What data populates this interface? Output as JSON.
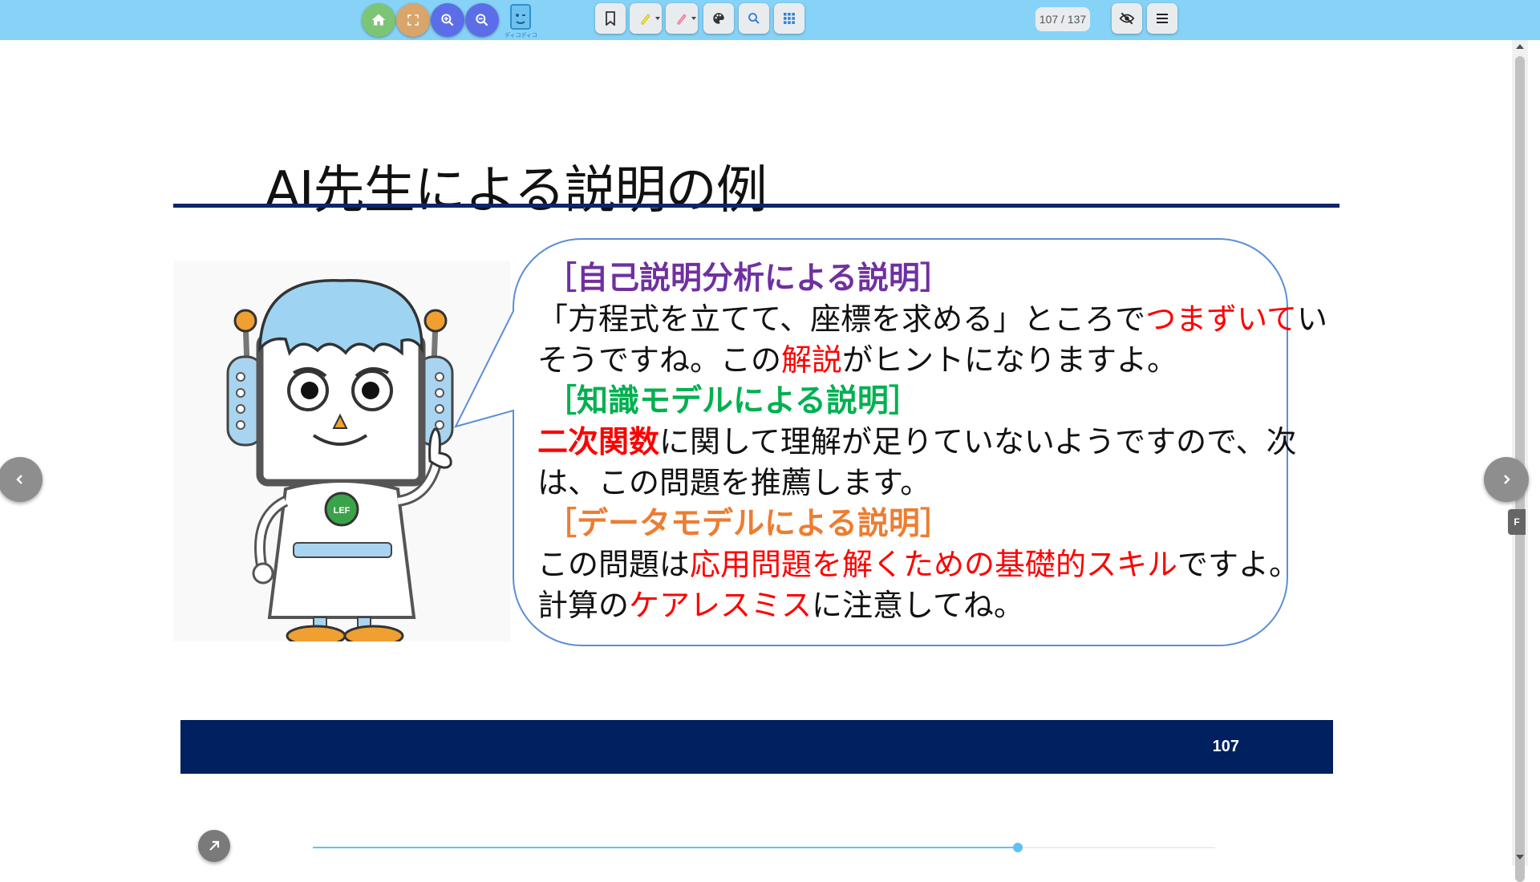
{
  "toolbar": {
    "buttons": [
      {
        "id": "home",
        "icon": "home-icon",
        "color": "#7cc576"
      },
      {
        "id": "fullscreen",
        "icon": "fullscreen-icon",
        "color": "#d9a56b"
      },
      {
        "id": "zoom-in",
        "icon": "zoom-in-icon",
        "color": "#5b6ee8"
      },
      {
        "id": "zoom-out",
        "icon": "zoom-out-icon",
        "color": "#5b6ee8"
      }
    ],
    "logo_text": "ディコディコ",
    "tools": [
      {
        "id": "bookmark",
        "icon": "bookmark-icon"
      },
      {
        "id": "highlighter",
        "icon": "highlighter-icon",
        "color": "#f2e84b"
      },
      {
        "id": "marker",
        "icon": "marker-icon",
        "color": "#f4a3b5"
      },
      {
        "id": "palette",
        "icon": "palette-icon"
      },
      {
        "id": "search",
        "icon": "search-icon"
      },
      {
        "id": "grid",
        "icon": "grid-icon"
      }
    ],
    "page_counter": "107 / 137",
    "right_tools": [
      {
        "id": "hide",
        "icon": "eye-off-icon"
      },
      {
        "id": "menu",
        "icon": "menu-icon"
      }
    ]
  },
  "slide": {
    "title": "AI先生による説明の例",
    "sections": [
      {
        "heading": "［自己説明分析による説明］",
        "heading_color": "#7030a0",
        "lines": [
          [
            {
              "text": "「方程式を立てて、座標を求める」ところで"
            },
            {
              "text": "つまずいて",
              "style": "red"
            },
            {
              "text": "い"
            }
          ],
          [
            {
              "text": "そうですね。この"
            },
            {
              "text": "解説",
              "style": "red"
            },
            {
              "text": "がヒントになりますよ。"
            }
          ]
        ]
      },
      {
        "heading": "［知識モデルによる説明］",
        "heading_color": "#00b050",
        "lines": [
          [
            {
              "text": "二次関数",
              "style": "red-bold"
            },
            {
              "text": "に関して理解が足りていないようですので、次"
            }
          ],
          [
            {
              "text": "は、この問題を推薦します。"
            }
          ]
        ]
      },
      {
        "heading": "［データモデルによる説明］",
        "heading_color": "#ed7d31",
        "lines": [
          [
            {
              "text": "この問題は"
            },
            {
              "text": "応用問題を解くための基礎的スキル",
              "style": "red"
            },
            {
              "text": "ですよ。"
            }
          ],
          [
            {
              "text": "計算の"
            },
            {
              "text": "ケアレスミス",
              "style": "red"
            },
            {
              "text": "に注意してね。"
            }
          ]
        ]
      }
    ],
    "mascot_badge": "LEF",
    "slide_number": "107"
  },
  "nav": {
    "prev_icon": "chevron-left-icon",
    "next_icon": "chevron-right-icon",
    "side_tab": "F",
    "expand_icon": "arrow-up-right-icon"
  },
  "progress": {
    "current": 107,
    "total": 137
  }
}
